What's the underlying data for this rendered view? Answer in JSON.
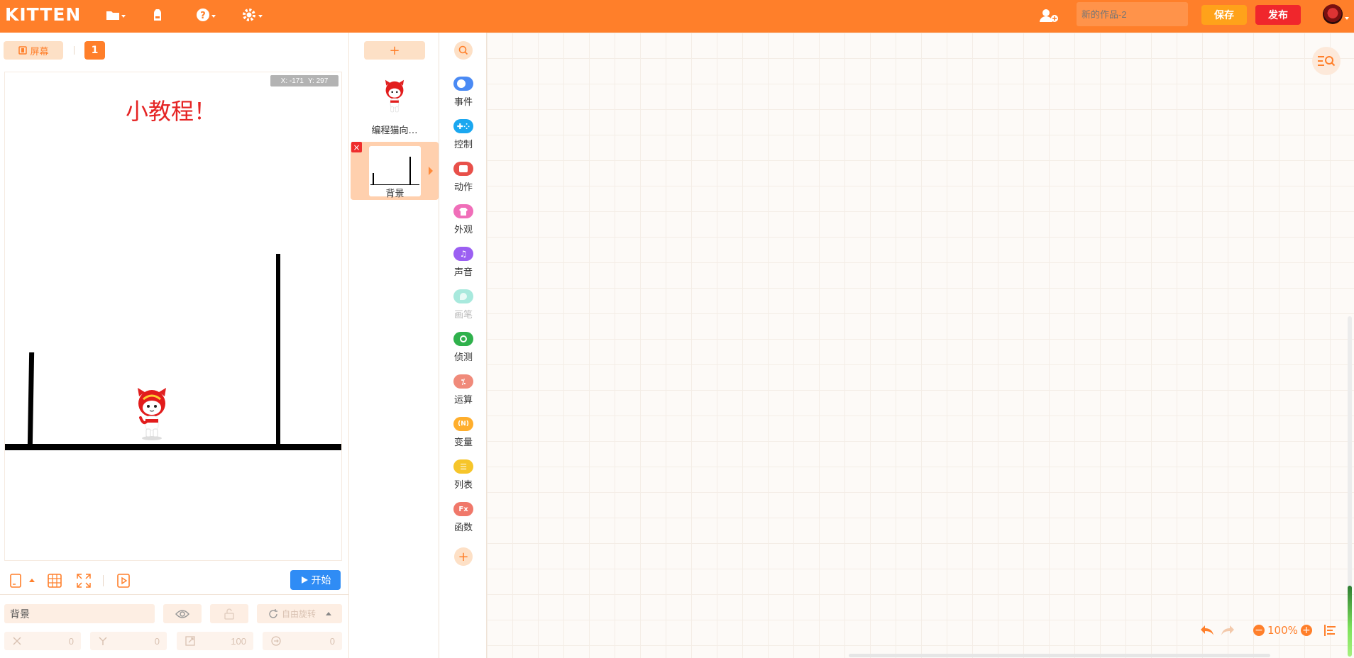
{
  "app": {
    "logo": "KITTEN",
    "project_title_placeholder": "新的作品-2",
    "save_label": "保存",
    "publish_label": "发布"
  },
  "stage": {
    "screen_button": "屏幕",
    "scene_number": "1",
    "coord_x": "X: -171",
    "coord_y": "Y: 297",
    "title_text": "小教程！",
    "start_button": "开始"
  },
  "properties": {
    "name_value": "背景",
    "rotation_label": "自由旋转",
    "x_value": "0",
    "y_value": "0",
    "size_value": "100",
    "direction_value": "0"
  },
  "sprites": {
    "items": [
      {
        "label": "编程猫向…"
      },
      {
        "label": "背景"
      }
    ]
  },
  "categories": [
    {
      "label": "事件",
      "color": "#4a8af4"
    },
    {
      "label": "控制",
      "color": "#1aa7f0"
    },
    {
      "label": "动作",
      "color": "#e8504a"
    },
    {
      "label": "外观",
      "color": "#f06eb9"
    },
    {
      "label": "声音",
      "color": "#9b5ff2"
    },
    {
      "label": "画笔",
      "color": "#a8e9dd"
    },
    {
      "label": "侦测",
      "color": "#2fb14c"
    },
    {
      "label": "运算",
      "color": "#f08a7a"
    },
    {
      "label": "变量",
      "color": "#ffae2c"
    },
    {
      "label": "列表",
      "color": "#f6c52a"
    },
    {
      "label": "函数",
      "color": "#f0786a"
    }
  ],
  "workspace": {
    "zoom_level": "100%"
  },
  "colors": {
    "brand": "#ff7f2a",
    "save": "#ffa21a",
    "publish": "#f0262c",
    "start": "#2f8cf5"
  }
}
